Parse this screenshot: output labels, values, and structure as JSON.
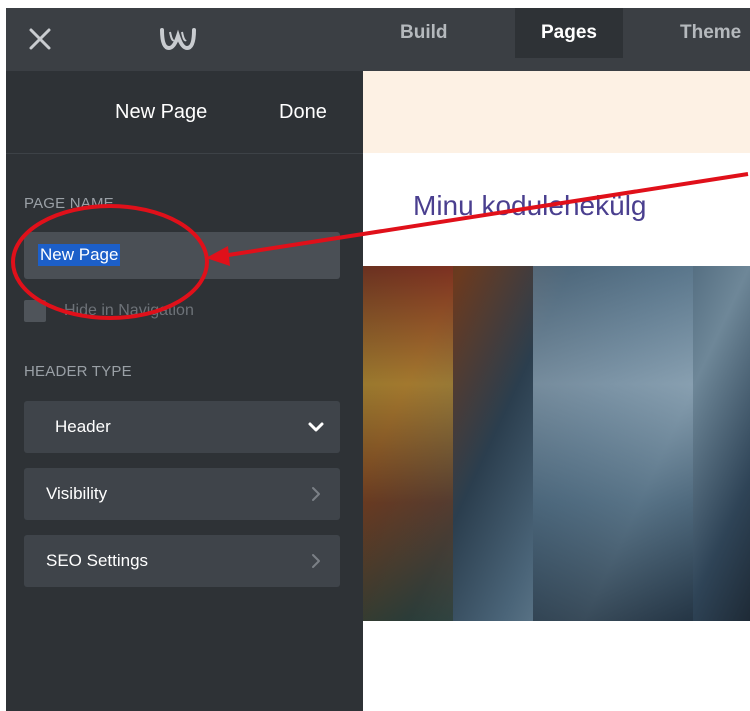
{
  "topbar": {
    "tabs": [
      {
        "label": "Build"
      },
      {
        "label": "Pages"
      },
      {
        "label": "Theme"
      }
    ]
  },
  "sidebar": {
    "title": "New Page",
    "done_label": "Done",
    "page_name_label": "PAGE NAME",
    "page_name_value": "New Page",
    "hide_in_navigation_label": "Hide in Navigation",
    "header_type_label": "HEADER TYPE",
    "header_selected": "Header",
    "visibility_label": "Visibility",
    "seo_settings_label": "SEO Settings"
  },
  "preview": {
    "site_title": "Minu kodulehekülg"
  },
  "colors": {
    "annotation": "#e0101a",
    "selection": "#1c5fc9",
    "sidebar_bg": "#2e3236",
    "topbar_bg": "#3b3f44"
  }
}
